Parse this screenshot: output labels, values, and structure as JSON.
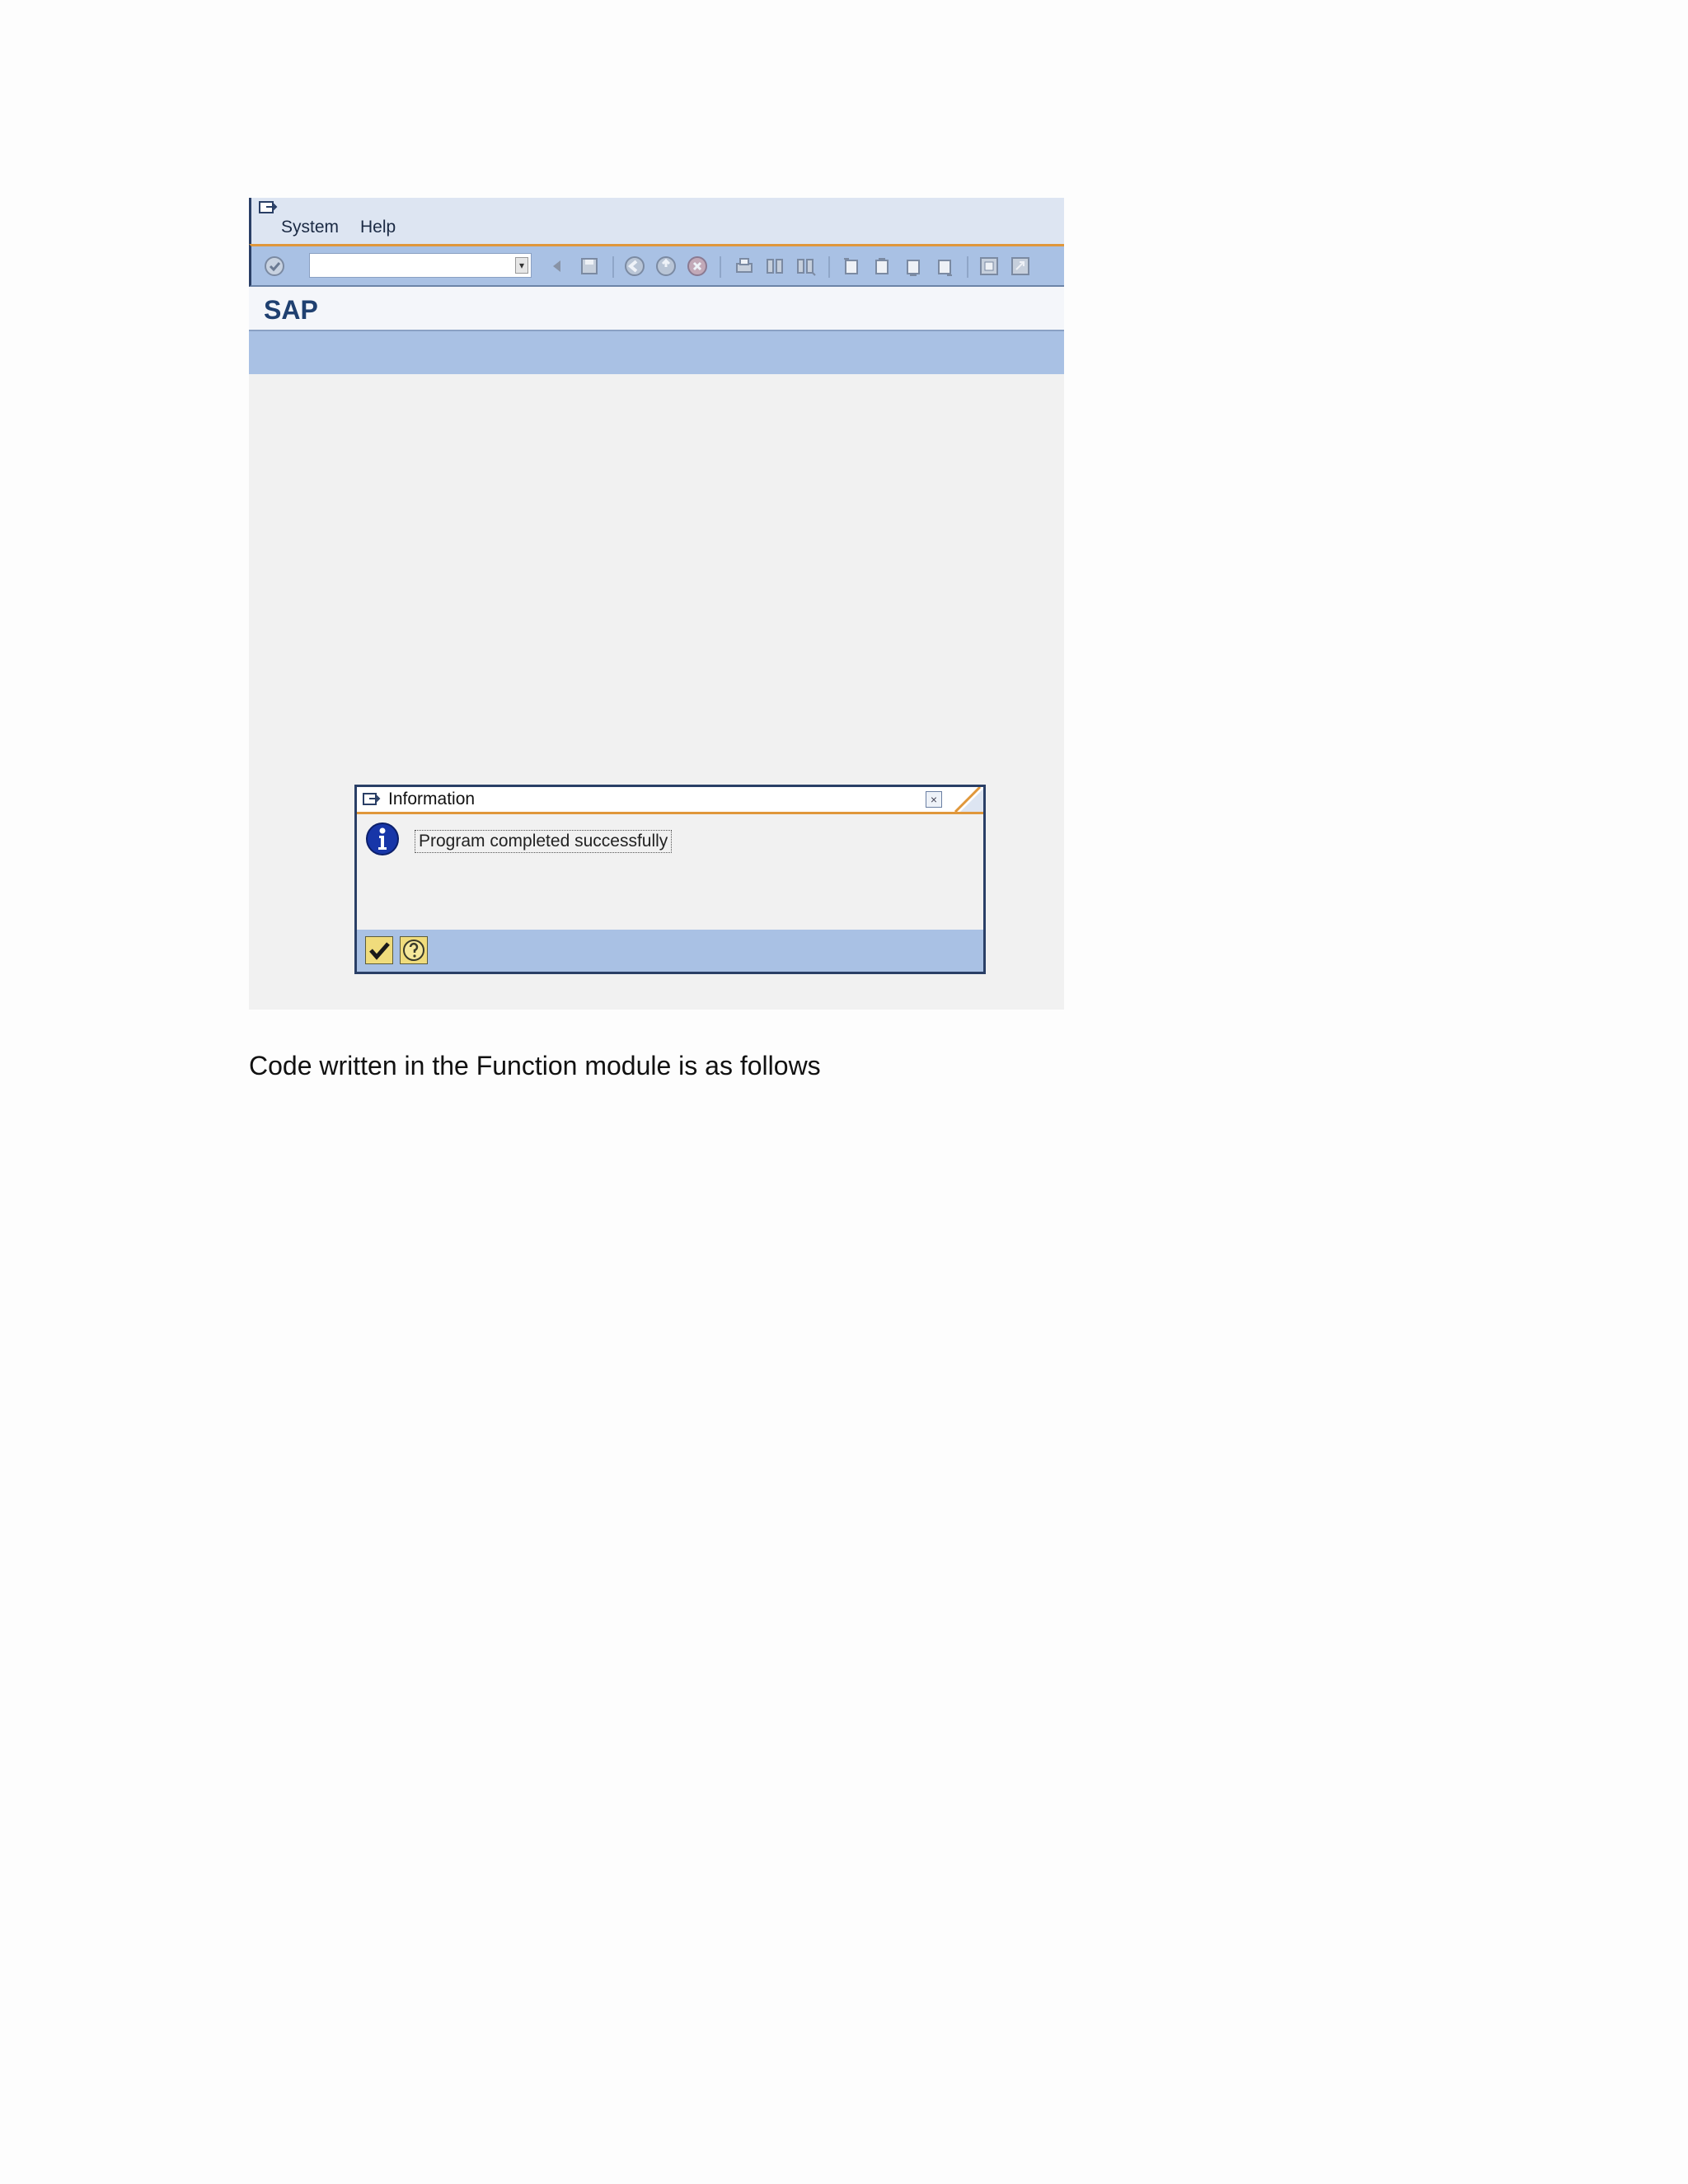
{
  "menubar": {
    "items": [
      "System",
      "Help"
    ]
  },
  "toolbar": {
    "command_field_value": "",
    "icons": [
      "enter-icon",
      "back-icon",
      "save-icon",
      "back-green-icon",
      "exit-icon",
      "cancel-icon",
      "print-icon",
      "find-icon",
      "find-next-icon",
      "first-page-icon",
      "previous-page-icon",
      "next-page-icon",
      "last-page-icon",
      "new-session-icon",
      "shortcut-icon"
    ]
  },
  "title": "SAP",
  "dialog": {
    "title": "Information",
    "message": "Program completed successfully",
    "buttons": [
      "confirm-checkmark-icon",
      "help-icon"
    ]
  },
  "caption": "Code written in the Function module is as follows",
  "colors": {
    "toolbar_blue": "#a9c1e4",
    "accent_orange": "#e0973b",
    "frame_dark": "#2a3f66",
    "title_blue": "#1f4070"
  }
}
